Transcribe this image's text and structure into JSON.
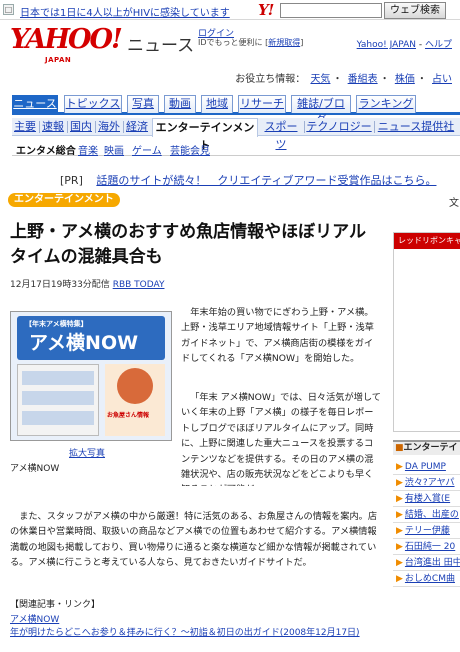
{
  "topbar": {
    "icon": "□",
    "ad_text": "日本では1日に4人以上がHIVに感染しています",
    "logo_mini": "Y!",
    "search_button": "ウェブ検索"
  },
  "header": {
    "logo": "YAHOO!",
    "logo_sub": "JAPAN",
    "section": "ニュース",
    "login": "ログイン",
    "login_desc": "IDでもっと便利に",
    "signup": "新規取得",
    "right_link1": "Yahoo! JAPAN",
    "right_sep": " - ",
    "right_link2": "ヘルプ"
  },
  "util": {
    "label": "お役立ち情報：",
    "items": [
      "天気",
      "番組表",
      "株価",
      "占い"
    ],
    "sep": "・"
  },
  "tabs1": [
    "ニュース",
    "トピックス",
    "写真",
    "動画",
    "地域",
    "リサーチ",
    "雑誌/ブログ",
    "ランキング"
  ],
  "tabs2": [
    "主要",
    "速報",
    "国内",
    "海外",
    "経済",
    "エンターテインメント",
    "スポーツ",
    "テクノロジー",
    "ニュース提供社"
  ],
  "tabs3": [
    "エンタメ総合",
    "音楽",
    "映画",
    "ゲーム",
    "芸能会見"
  ],
  "pr": {
    "label": "[PR]",
    "text": "話題のサイトが続々！　クリエイティブアワード受賞作品はこちら。"
  },
  "category": "エンターテインメント",
  "right_edge": "文",
  "article": {
    "title": "上野・アメ横のおすすめ魚店情報やほぼリアルタイムの混雑具合も",
    "date": "12月17日19時33分配信",
    "source": "RBB TODAY",
    "photo": {
      "banner": "【年末アメ横特集】",
      "big": "アメ横NOW",
      "cap": "お魚屋さん情報",
      "enlarge": "拡大写真",
      "caption": "アメ横NOW"
    },
    "p1": "年末年始の買い物でにぎわう上野・アメ横。上野・浅草エリア地域情報サイト「上野・浅草ガイドネット」で、アメ横商店街の模様をガイドしてくれる「アメ横NOW」を開始した。",
    "p2": "「年末 アメ横NOW」では、日々活気が増していく年末の上野「アメ横」の様子を毎日レポートしブログでほぼリアルタイムにアップ。同時に、上野に関連した重大ニュースを投票するコンテンツなどを提供する。その日のアメ横の混雑状況や、店の販売状況などをどこよりも早く知ることが可能だ。",
    "p3": "また、スタッフがアメ横の中から厳選！特に活気のある、お魚屋さんの情報を案内。店の休業日や営業時間、取扱いの商品などアメ横での位置もあわせて紹介する。アメ横情報満載の地図も掲載しており、買い物帰りに通ると楽な横道など細かな情報が掲載されている。アメ横に行こうと考えている人なら、見ておきたいガイドサイトだ。",
    "links_head": "【関連記事・リンク】",
    "links": [
      "アメ横NOW",
      "年が明けたらどこへお参り＆拝みに行く？～初詣＆初日の出ガイド(2008年12月17日)"
    ]
  },
  "sidebar": {
    "box1_head": "レッドリボンキャ",
    "box2_head": "エンターテイ",
    "box2_mark": "■",
    "items": [
      "DA PUMP ",
      "渋々?アヤパ",
      "有楼入賞(E",
      "結婚、出産の",
      "テリー伊藤",
      "石田純一 20",
      "台湾進出 田中",
      "おしめCM曲"
    ]
  }
}
